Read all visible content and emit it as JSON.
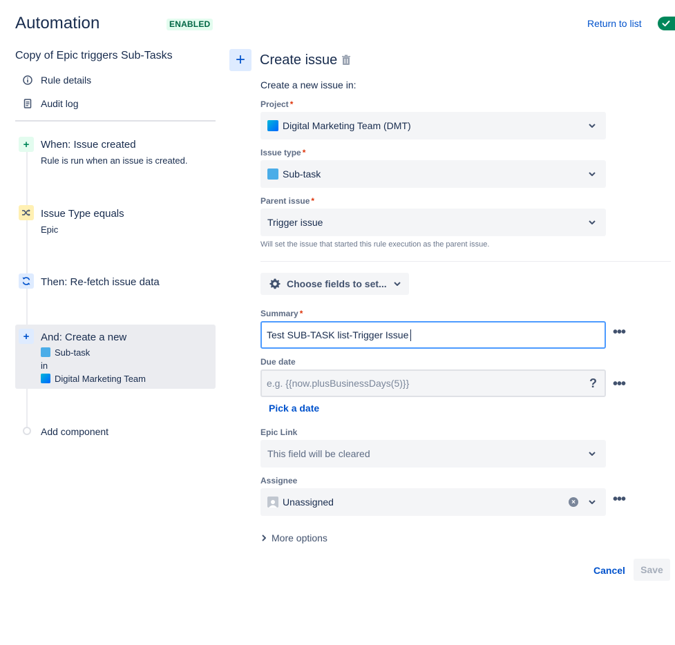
{
  "header": {
    "title": "Automation",
    "status": "ENABLED",
    "return_link": "Return to list"
  },
  "sidebar": {
    "rule_name": "Copy of Epic triggers Sub-Tasks",
    "nav": [
      {
        "label": "Rule details",
        "icon": "info-icon"
      },
      {
        "label": "Audit log",
        "icon": "document-icon"
      }
    ],
    "steps": [
      {
        "title": "When: Issue created",
        "desc": "Rule is run when an issue is created.",
        "icon": "plus-icon",
        "color": "#e3fcef"
      },
      {
        "title": "Issue Type equals",
        "desc": "Epic",
        "icon": "shuffle-icon",
        "color": "#fff0b3"
      },
      {
        "title": "Then: Re-fetch issue data",
        "desc": "",
        "icon": "refresh-icon",
        "color": "#deebff"
      },
      {
        "title": "And: Create a new",
        "line1": "Sub-task",
        "line2": "in",
        "line3": "Digital Marketing Team",
        "icon": "plus-icon",
        "color": "#deebff"
      }
    ],
    "add_component": "Add component"
  },
  "panel": {
    "title": "Create issue",
    "intro": "Create a new issue in:",
    "project": {
      "label": "Project",
      "required": "*",
      "value": "Digital Marketing Team (DMT)"
    },
    "issue_type": {
      "label": "Issue type",
      "required": "*",
      "value": "Sub-task"
    },
    "parent": {
      "label": "Parent issue",
      "required": "*",
      "value": "Trigger issue",
      "helper": "Will set the issue that started this rule execution as the parent issue."
    },
    "choose_fields": "Choose fields to set...",
    "summary": {
      "label": "Summary",
      "required": "*",
      "value": "Test SUB-TASK list-Trigger Issue"
    },
    "due_date": {
      "label": "Due date",
      "placeholder": "e.g. {{now.plusBusinessDays(5)}}",
      "help": "?",
      "link": "Pick a date"
    },
    "epic_link": {
      "label": "Epic Link",
      "value": "This field will be cleared"
    },
    "assignee": {
      "label": "Assignee",
      "value": "Unassigned"
    },
    "more_options": "More options",
    "cancel": "Cancel",
    "save": "Save",
    "more_dots": "•••"
  },
  "colors": {
    "accent": "#0052cc",
    "focus": "#4c9aff",
    "enabled_bg": "#e3fcef",
    "enabled_text": "#006644",
    "required": "#de350b"
  }
}
